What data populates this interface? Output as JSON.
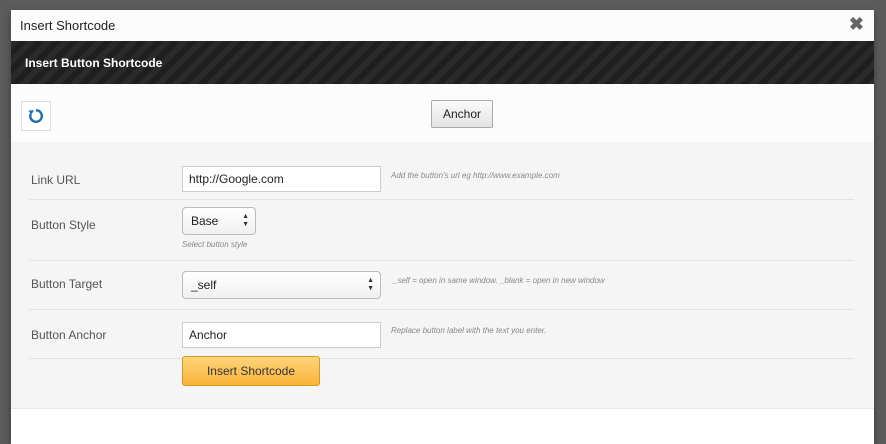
{
  "modal": {
    "title": "Insert Shortcode",
    "close_symbol": "✖",
    "header": "Insert Button Shortcode"
  },
  "preview": {
    "refresh_icon": "refresh-icon",
    "button_label": "Anchor"
  },
  "form": {
    "link_url": {
      "label": "Link URL",
      "value": "http://Google.com",
      "hint": "Add the button's url eg http://www.example.com"
    },
    "button_style": {
      "label": "Button Style",
      "selected": "Base",
      "hint": "Select button style"
    },
    "button_target": {
      "label": "Button Target",
      "selected": "_self",
      "hint": "_self = open in same window. _blank = open in new window"
    },
    "button_anchor": {
      "label": "Button Anchor",
      "value": "Anchor",
      "hint": "Replace button label with the text you enter."
    },
    "submit_label": "Insert Shortcode"
  },
  "colors": {
    "accent_button": "#f8b43a",
    "dark_header": "#2a2a2a",
    "refresh_blue": "#1e6fb5"
  }
}
